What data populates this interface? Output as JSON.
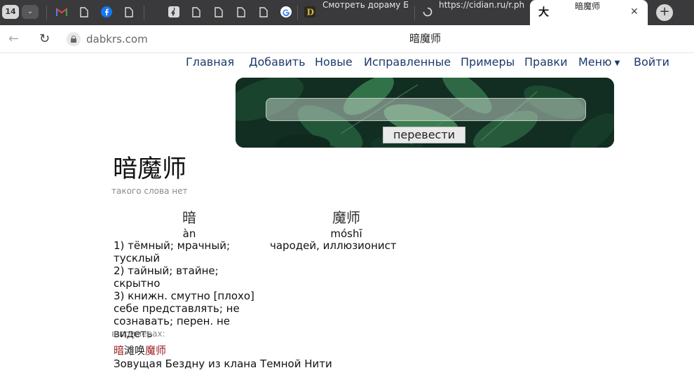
{
  "browser": {
    "tab_count": "14",
    "tabs": [
      {
        "label": "Смотреть дораму Ба"
      },
      {
        "label": "https://cidian.ru/r.ph"
      }
    ],
    "active_tab": {
      "title": "暗魔师",
      "favicon_text": "大"
    },
    "address": {
      "domain": "dabkrs.com",
      "page_title": "暗魔师"
    }
  },
  "site_nav": {
    "items": [
      {
        "label": "Главная"
      },
      {
        "label": "Добавить"
      },
      {
        "label": "Новые"
      },
      {
        "label": "Исправленные"
      },
      {
        "label": "Примеры"
      },
      {
        "label": "Правки"
      },
      {
        "label": "Меню"
      },
      {
        "label": "Войти"
      }
    ]
  },
  "search": {
    "value": "",
    "button_label": "перевести"
  },
  "entry": {
    "headword": "暗魔师",
    "status": "такого слова нет",
    "parts": [
      {
        "hanzi": "暗",
        "pinyin": "àn",
        "definitions": [
          "1) тёмный; мрачный;",
          "тусклый",
          "2) тайный; втайне; скрытно",
          "3) книжн. смутно [плохо]",
          "себе представлять; не",
          "сознавать; перен. не видеть"
        ]
      },
      {
        "hanzi": "魔师",
        "pinyin": "móshī",
        "definitions": [
          "чародей, иллюзионист"
        ]
      }
    ]
  },
  "examples": {
    "label": "в примерах:",
    "items": [
      {
        "zh_parts": [
          {
            "text": "暗",
            "highlight": true
          },
          {
            "text": "滩唤",
            "highlight": false
          },
          {
            "text": "魔师",
            "highlight": true
          }
        ],
        "ru": "Зовущая Бездну из клана Темной Нити"
      }
    ]
  },
  "colors": {
    "tabstrip": "#3a3a3c",
    "nav_link": "#1a3a6b",
    "highlight": "#9b1c1c"
  }
}
